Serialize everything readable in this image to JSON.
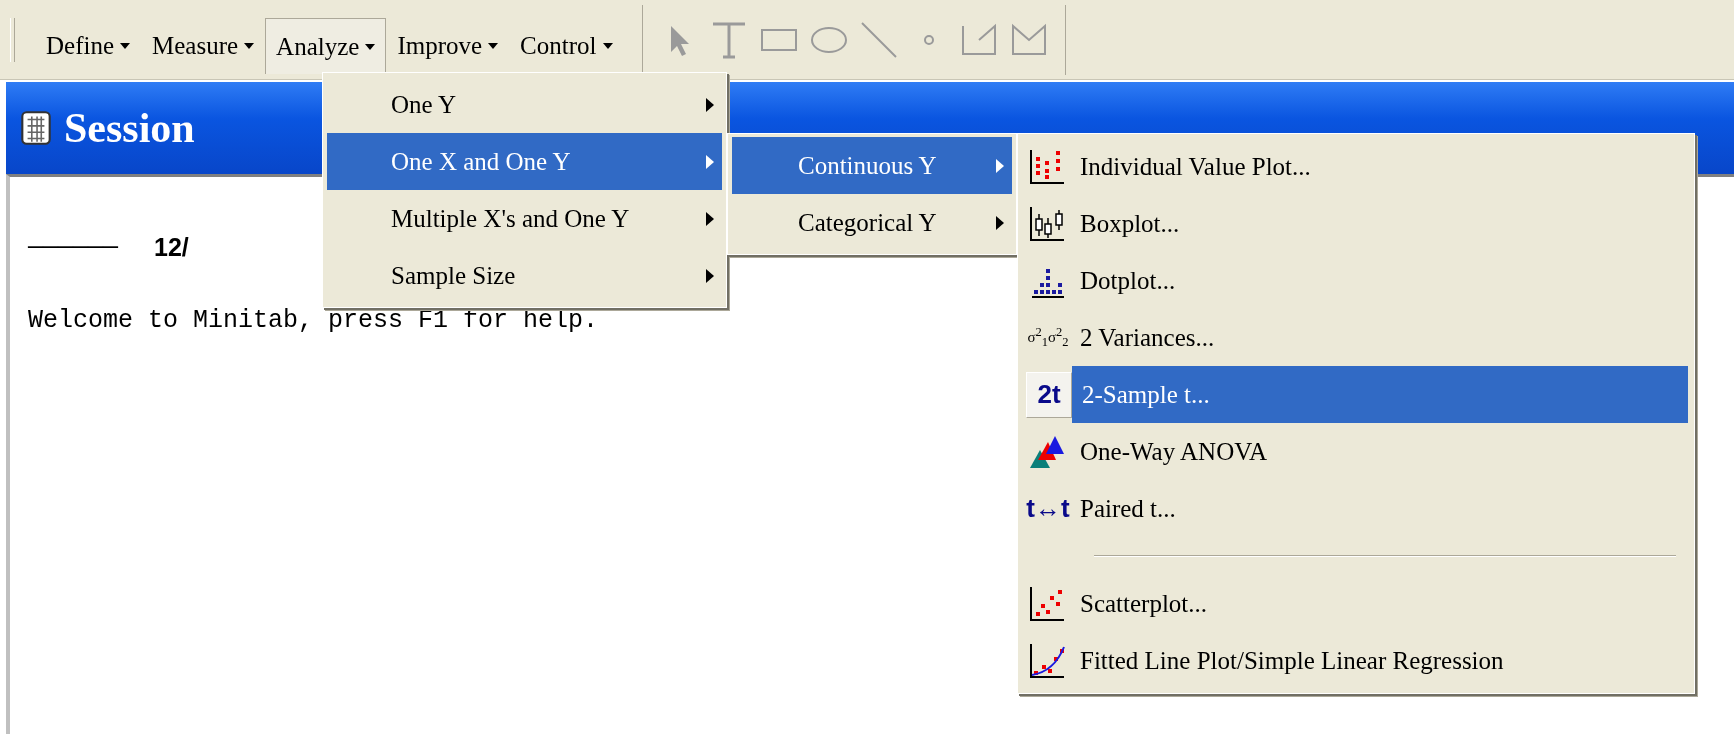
{
  "menubar": [
    {
      "label": "Define",
      "selected": false
    },
    {
      "label": "Measure",
      "selected": false
    },
    {
      "label": "Analyze",
      "selected": true
    },
    {
      "label": "Improve",
      "selected": false
    },
    {
      "label": "Control",
      "selected": false
    }
  ],
  "session": {
    "title": "Session",
    "rule": "——————",
    "date": "12/",
    "welcome": "Welcome to Minitab, press F1 for help."
  },
  "menus": [
    {
      "items": [
        {
          "kind": "item",
          "label": "One Y",
          "submenu": true,
          "selected": false
        },
        {
          "kind": "item",
          "label": "One X and One Y",
          "submenu": true,
          "selected": true
        },
        {
          "kind": "item",
          "label": "Multiple X's and One Y",
          "submenu": true,
          "selected": false
        },
        {
          "kind": "item",
          "label": "Sample Size",
          "submenu": true,
          "selected": false
        }
      ]
    },
    {
      "items": [
        {
          "kind": "item",
          "label": "Continuous Y",
          "submenu": true,
          "selected": true
        },
        {
          "kind": "item",
          "label": "Categorical Y",
          "submenu": true,
          "selected": false
        }
      ]
    },
    {
      "items": [
        {
          "kind": "item",
          "label": "Individual Value Plot...",
          "selected": false
        },
        {
          "kind": "item",
          "label": "Boxplot...",
          "selected": false
        },
        {
          "kind": "item",
          "label": "Dotplot...",
          "selected": false
        },
        {
          "kind": "item",
          "label": "2 Variances...",
          "icon_text": "σ$^{2}$$_{1}$σ$^{2}$$_{2}$",
          "selected": false
        },
        {
          "kind": "item",
          "label": "2-Sample t...",
          "icon_text": "2t",
          "selected": true
        },
        {
          "kind": "item",
          "label": "One-Way ANOVA",
          "selected": false
        },
        {
          "kind": "item",
          "label": "Paired t...",
          "icon_text": "t↔t",
          "selected": false
        },
        {
          "kind": "separator"
        },
        {
          "kind": "item",
          "label": "Scatterplot...",
          "selected": false
        },
        {
          "kind": "item",
          "label": "Fitted Line Plot/Simple Linear Regression",
          "selected": false
        }
      ]
    }
  ]
}
